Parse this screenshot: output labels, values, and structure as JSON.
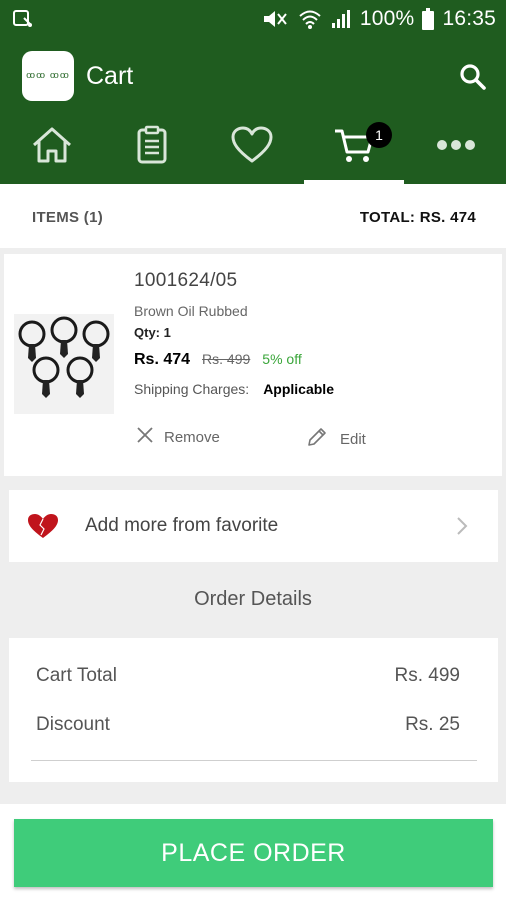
{
  "status_bar": {
    "battery": "100%",
    "time": "16:35"
  },
  "app_bar": {
    "title": "Cart",
    "logo_text": "ꝏꝏ ꝏꝏ"
  },
  "tabs": [
    {
      "name": "home",
      "icon": "home-icon"
    },
    {
      "name": "orders",
      "icon": "clipboard-icon"
    },
    {
      "name": "favorites",
      "icon": "heart-icon"
    },
    {
      "name": "cart",
      "icon": "cart-icon",
      "badge": "1",
      "active": true
    },
    {
      "name": "more",
      "icon": "more-icon"
    }
  ],
  "summary": {
    "items": "ITEMS (1)",
    "total": "TOTAL: RS. 474"
  },
  "product": {
    "sku": "1001624/05",
    "name": "Brown Oil Rubbed",
    "qty": "Qty: 1",
    "price": "Rs. 474",
    "original_price": "Rs. 499",
    "discount": "5% off",
    "shipping_label": "Shipping Charges:",
    "shipping_value": "Applicable",
    "remove_label": "Remove",
    "edit_label": "Edit"
  },
  "favorite": {
    "label": "Add more from favorite"
  },
  "order_details": {
    "title": "Order Details",
    "rows": [
      {
        "label": "Cart Total",
        "value": "Rs. 499"
      },
      {
        "label": "Discount",
        "value": "Rs. 25"
      }
    ]
  },
  "place_order": {
    "label": "PLACE ORDER"
  },
  "colors": {
    "primary": "#1f5c1f",
    "accent": "#3fcc7a",
    "discount": "#3aa63a",
    "heart": "#c0141c"
  }
}
